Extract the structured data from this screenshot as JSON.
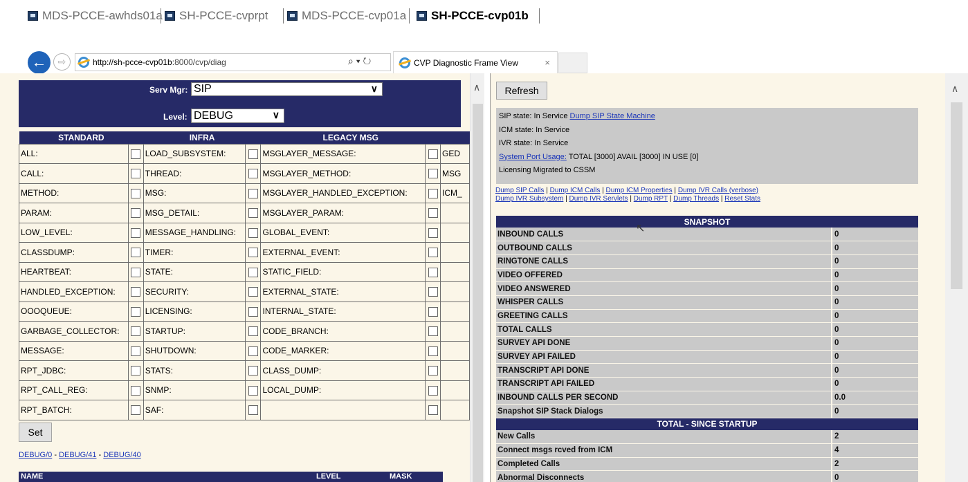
{
  "rdp_tabs": [
    {
      "label": "MDS-PCCE-awhds01a"
    },
    {
      "label": "SH-PCCE-cvprpt"
    },
    {
      "label": "MDS-PCCE-cvp01a"
    },
    {
      "label": "SH-PCCE-cvp01b",
      "active": true
    }
  ],
  "browser": {
    "url_host": "http://sh-pcce-cvp01b",
    "url_rest": ":8000/cvp/diag",
    "addr_tools": "⌕ ▾ ↻",
    "tab_title": "CVP Diagnostic Frame View",
    "tab_close": "×"
  },
  "left": {
    "serv_mgr_label": "Serv Mgr:",
    "serv_mgr_value": "SIP",
    "level_label": "Level:",
    "level_value": "DEBUG",
    "columns": [
      "STANDARD",
      "INFRA",
      "LEGACY MSG"
    ],
    "rows": [
      [
        "ALL:",
        "LOAD_SUBSYSTEM:",
        "MSGLAYER_MESSAGE:",
        "GED"
      ],
      [
        "CALL:",
        "THREAD:",
        "MSGLAYER_METHOD:",
        "MSG"
      ],
      [
        "METHOD:",
        "MSG:",
        "MSGLAYER_HANDLED_EXCEPTION:",
        "ICM_"
      ],
      [
        "PARAM:",
        "MSG_DETAIL:",
        "MSGLAYER_PARAM:",
        ""
      ],
      [
        "LOW_LEVEL:",
        "MESSAGE_HANDLING:",
        "GLOBAL_EVENT:",
        ""
      ],
      [
        "CLASSDUMP:",
        "TIMER:",
        "EXTERNAL_EVENT:",
        ""
      ],
      [
        "HEARTBEAT:",
        "STATE:",
        "STATIC_FIELD:",
        ""
      ],
      [
        "HANDLED_EXCEPTION:",
        "SECURITY:",
        "EXTERNAL_STATE:",
        ""
      ],
      [
        "OOOQUEUE:",
        "LICENSING:",
        "INTERNAL_STATE:",
        ""
      ],
      [
        "GARBAGE_COLLECTOR:",
        "STARTUP:",
        "CODE_BRANCH:",
        ""
      ],
      [
        "MESSAGE:",
        "SHUTDOWN:",
        "CODE_MARKER:",
        ""
      ],
      [
        "RPT_JDBC:",
        "STATS:",
        "CLASS_DUMP:",
        ""
      ],
      [
        "RPT_CALL_REG:",
        "SNMP:",
        "LOCAL_DUMP:",
        ""
      ],
      [
        "RPT_BATCH:",
        "SAF:",
        "",
        ""
      ]
    ],
    "set_label": "Set",
    "debug_links": [
      "DEBUG/0",
      "DEBUG/41",
      "DEBUG/40"
    ],
    "debug_sep": " - ",
    "name_header": {
      "name": "NAME",
      "level": "LEVEL",
      "mask": "MASK"
    }
  },
  "right": {
    "refresh_label": "Refresh",
    "sip_state": "SIP state: In Service",
    "dump_sip_link": "Dump SIP State Machine",
    "icm_state": "ICM state: In Service",
    "ivr_state": "IVR state: In Service",
    "port_usage_link": "System Port Usage:",
    "port_usage_text": "TOTAL [3000] AVAIL [3000] IN USE [0]",
    "licensing": "Licensing Migrated to CSSM",
    "dump_links_line1": [
      "Dump SIP Calls",
      "Dump ICM Calls",
      "Dump ICM Properties",
      "Dump IVR Calls (verbose)"
    ],
    "dump_links_line2": [
      "Dump IVR Subsystem",
      "Dump IVR Servlets",
      "Dump RPT",
      "Dump Threads",
      "Reset Stats"
    ],
    "link_sep": " | ",
    "snapshot_header": "SNAPSHOT",
    "snapshot": [
      {
        "name": "INBOUND CALLS",
        "value": "0"
      },
      {
        "name": "OUTBOUND CALLS",
        "value": "0"
      },
      {
        "name": "RINGTONE CALLS",
        "value": "0"
      },
      {
        "name": "VIDEO OFFERED",
        "value": "0"
      },
      {
        "name": "VIDEO ANSWERED",
        "value": "0"
      },
      {
        "name": "WHISPER CALLS",
        "value": "0"
      },
      {
        "name": "GREETING CALLS",
        "value": "0"
      },
      {
        "name": "TOTAL CALLS",
        "value": "0"
      },
      {
        "name": "SURVEY API DONE",
        "value": "0"
      },
      {
        "name": "SURVEY API FAILED",
        "value": "0"
      },
      {
        "name": "TRANSCRIPT API DONE",
        "value": "0"
      },
      {
        "name": "TRANSCRIPT API FAILED",
        "value": "0"
      },
      {
        "name": "INBOUND CALLS PER SECOND",
        "value": "0.0"
      },
      {
        "name": "Snapshot SIP Stack Dialogs",
        "value": "0"
      }
    ],
    "total_header": "TOTAL - SINCE STARTUP",
    "total": [
      {
        "name": "New Calls",
        "value": "2"
      },
      {
        "name": "Connect msgs rcved from ICM",
        "value": "4"
      },
      {
        "name": "Completed Calls",
        "value": "2"
      },
      {
        "name": "Abnormal Disconnects",
        "value": "0"
      }
    ]
  }
}
